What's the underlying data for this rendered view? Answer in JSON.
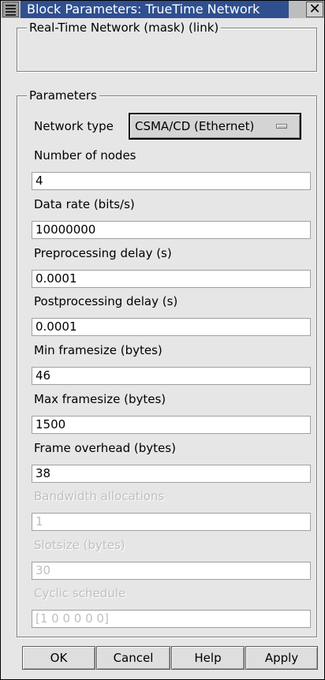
{
  "window": {
    "title": "Block Parameters: TrueTime Network",
    "close_symbol": "✕"
  },
  "mask_group": {
    "legend": "Real-Time Network (mask) (link)"
  },
  "parameters_group": {
    "legend": "Parameters",
    "network_type": {
      "label": "Network type",
      "value": "CSMA/CD (Ethernet)"
    },
    "fields": [
      {
        "label": "Number of nodes",
        "value": "4",
        "enabled": true
      },
      {
        "label": "Data rate (bits/s)",
        "value": "10000000",
        "enabled": true
      },
      {
        "label": "Preprocessing delay (s)",
        "value": "0.0001",
        "enabled": true
      },
      {
        "label": "Postprocessing delay (s)",
        "value": "0.0001",
        "enabled": true
      },
      {
        "label": "Min framesize (bytes)",
        "value": "46",
        "enabled": true
      },
      {
        "label": "Max framesize (bytes)",
        "value": "1500",
        "enabled": true
      },
      {
        "label": "Frame overhead (bytes)",
        "value": "38",
        "enabled": true
      },
      {
        "label": "Bandwidth allocations",
        "value": "1",
        "enabled": false
      },
      {
        "label": "Slotsize (bytes)",
        "value": "30",
        "enabled": false
      },
      {
        "label": "Cyclic schedule",
        "value": "[1 0 0 0 0 0]",
        "enabled": false
      }
    ]
  },
  "buttons": {
    "ok": "OK",
    "cancel": "Cancel",
    "help": "Help",
    "apply": "Apply"
  },
  "icons": {
    "window_menu": "window-menu-icon",
    "close": "close-icon",
    "dropdown": "option-menu-indicator-icon"
  }
}
